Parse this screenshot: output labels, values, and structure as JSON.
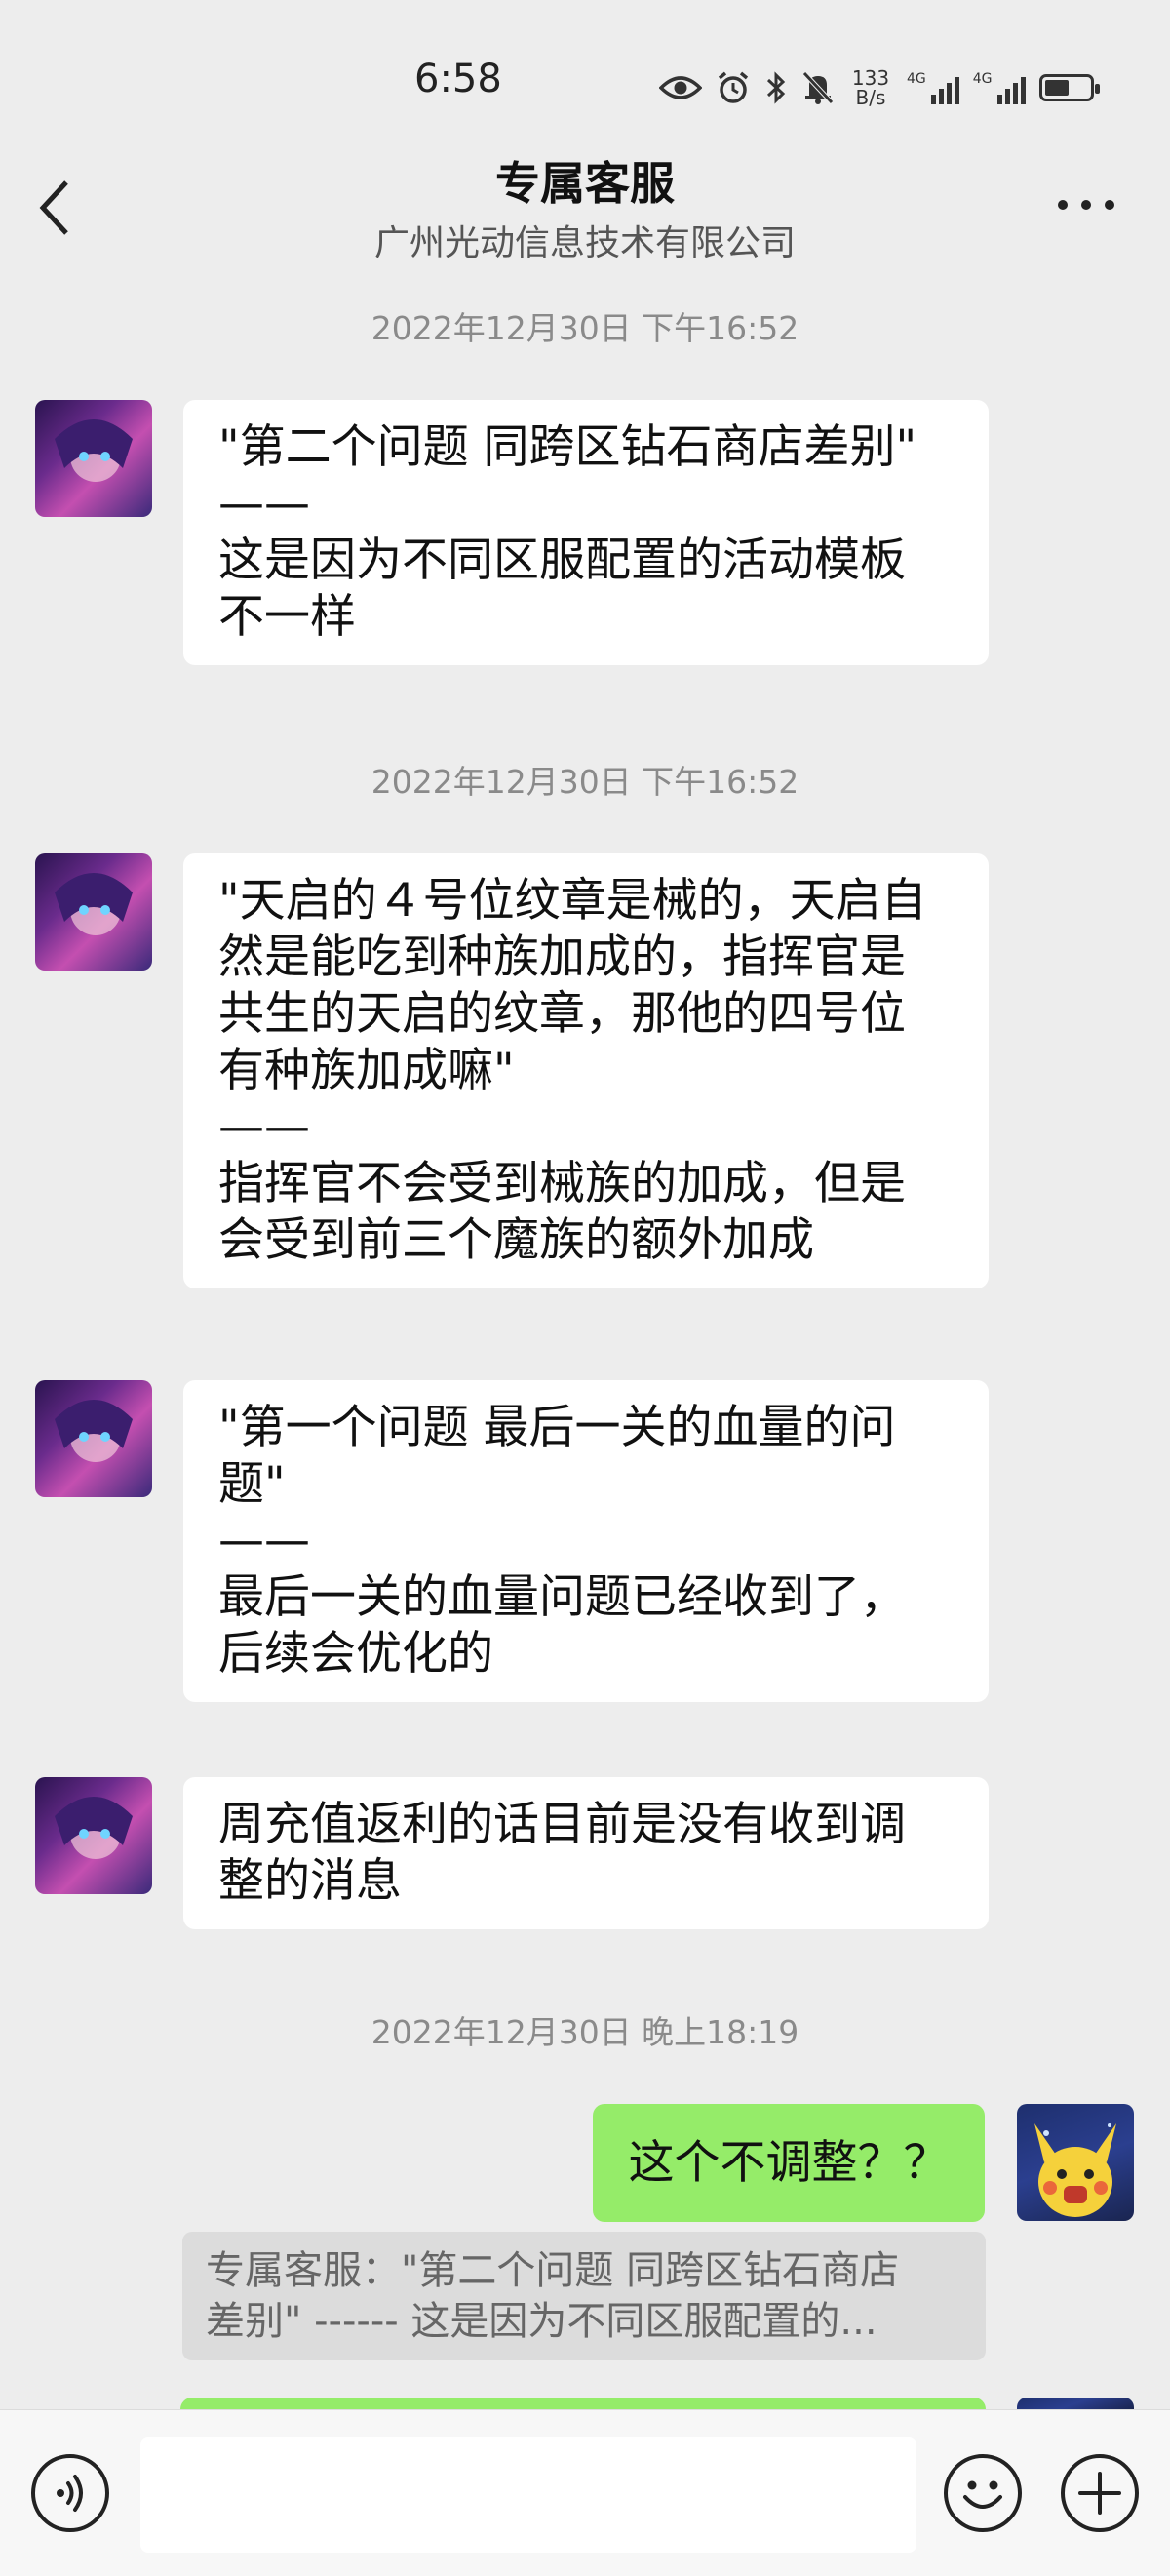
{
  "status_bar": {
    "time": "6:58",
    "net_speed_top": "133",
    "net_speed_bottom": "B/s",
    "signal1_label": "4G",
    "signal2_label": "4G",
    "battery_level": 0.55,
    "icons": [
      "eye-icon",
      "alarm-icon",
      "bluetooth-icon",
      "mute-icon"
    ]
  },
  "header": {
    "title": "专属客服",
    "subtitle": "广州光动信息技术有限公司",
    "icons": [
      "back-arrow-icon",
      "more-icon"
    ]
  },
  "chat": {
    "timestamps": [
      "2022年12月30日 下午16:52",
      "2022年12月30日 下午16:52",
      "2022年12月30日 晚上18:19"
    ],
    "messages": [
      {
        "sender": "专属客服",
        "text": "\"第二个问题 同跨区钻石商店差别\"\n——\n这是因为不同区服配置的活动模板\n不一样"
      },
      {
        "sender": "专属客服",
        "text": "\"天启的４号位纹章是械的，天启自\n然是能吃到种族加成的，指挥官是\n共生的天启的纹章，那他的四号位\n有种族加成嘛\"\n——\n指挥官不会受到械族的加成，但是\n会受到前三个魔族的额外加成"
      },
      {
        "sender": "专属客服",
        "text": "\"第一个问题 最后一关的血量的问\n题\"\n——\n最后一关的血量问题已经收到了，\n后续会优化的"
      },
      {
        "sender": "专属客服",
        "text": "周充值返利的话目前是没有收到调\n整的消息"
      },
      {
        "sender": "me",
        "text": "这个不调整？？"
      }
    ],
    "quote": "专属客服：\"第二个问题 同跨区钻石商店\n差别\" ------ 这是因为不同区服配置的..."
  },
  "input_bar": {
    "message_value": "",
    "icons": [
      "voice-icon",
      "emoji-icon",
      "add-icon"
    ]
  }
}
